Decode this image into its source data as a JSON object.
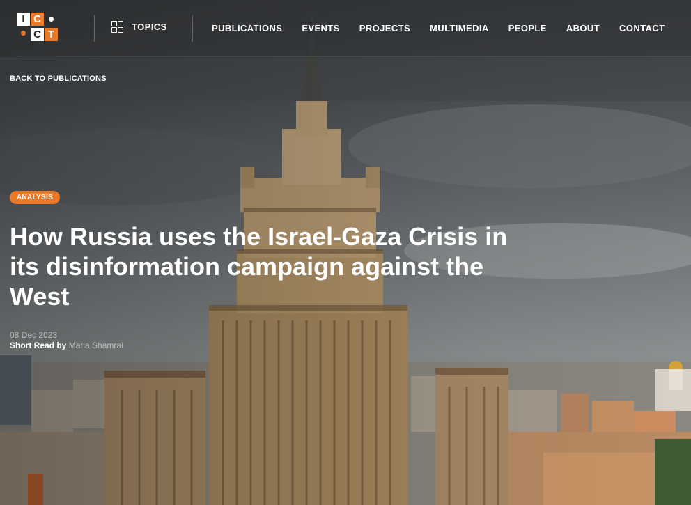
{
  "logo": {
    "letters": [
      "I",
      "C",
      "C",
      "T"
    ],
    "accent": "#ea7a2a"
  },
  "nav": {
    "topics_label": "TOPICS",
    "items": [
      "PUBLICATIONS",
      "EVENTS",
      "PROJECTS",
      "MULTIMEDIA",
      "PEOPLE",
      "ABOUT",
      "CONTACT"
    ]
  },
  "back_link": "BACK TO PUBLICATIONS",
  "article": {
    "category": "ANALYSIS",
    "title": "How Russia uses the Israel-Gaza Crisis in its disinformation campaign against the West",
    "date": "08 Dec 2023",
    "type_prefix": "Short Read by",
    "author": "Maria Shamrai"
  },
  "colors": {
    "accent": "#ea7a2a",
    "text": "#ffffff"
  }
}
